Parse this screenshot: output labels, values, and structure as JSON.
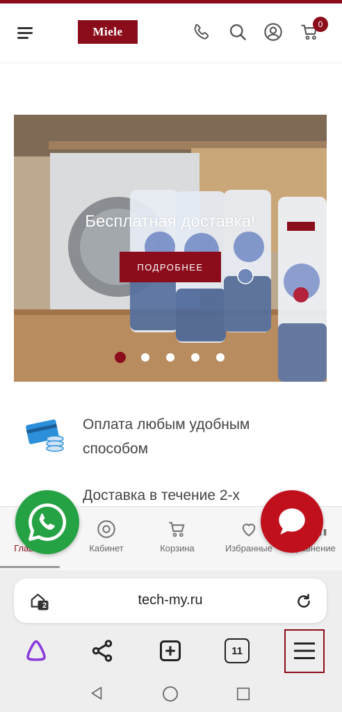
{
  "header": {
    "logo_text": "Miele",
    "cart_count": "0",
    "icons": [
      "menu-icon",
      "phone-icon",
      "search-icon",
      "account-icon",
      "cart-icon"
    ]
  },
  "banner": {
    "title": "Бесплатная доставка!",
    "button_label": "ПОДРОБНЕЕ",
    "slide_count": 5,
    "active_slide": 1
  },
  "features": [
    {
      "icon": "payment-card-icon",
      "line1": "Оплата любым удобным",
      "line2": "способом"
    },
    {
      "icon": "delivery-icon",
      "line1": "Доставка в течение 2-х",
      "line2": ""
    }
  ],
  "bottom_nav": {
    "items": [
      {
        "label": "Главная",
        "icon": "home-icon"
      },
      {
        "label": "Кабинет",
        "icon": "account-icon"
      },
      {
        "label": "Корзина",
        "icon": "cart-icon"
      },
      {
        "label": "Избранные",
        "icon": "heart-icon"
      },
      {
        "label": "Сравнение",
        "icon": "compare-icon"
      }
    ]
  },
  "browser": {
    "url": "tech-my.ru",
    "tab_badge": "2",
    "tabs_count": "11"
  },
  "colors": {
    "brand": "#8b0c1b",
    "whatsapp": "#25a244",
    "chat": "#c0101c"
  }
}
